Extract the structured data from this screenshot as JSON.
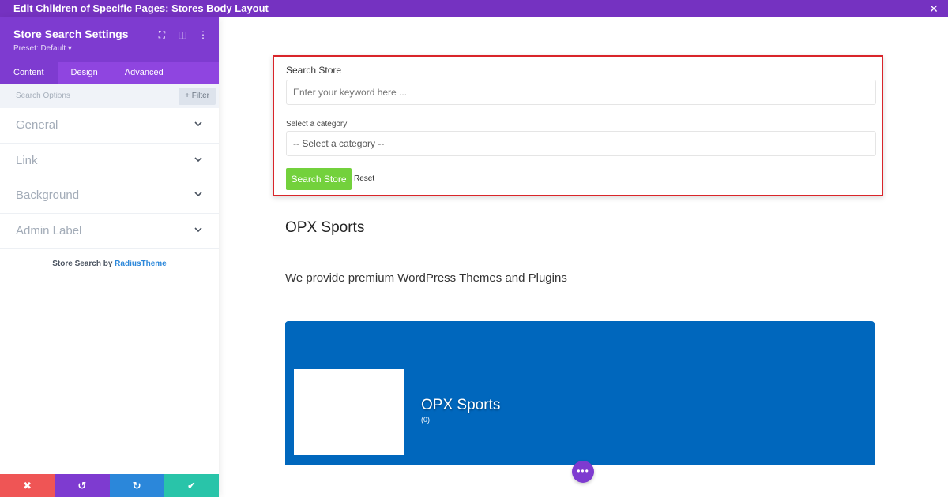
{
  "window": {
    "title": "Edit Children of Specific Pages: Stores Body Layout"
  },
  "panel": {
    "title": "Store Search Settings",
    "preset": "Preset: Default ▾",
    "tabs": [
      {
        "label": "Content",
        "active": true
      },
      {
        "label": "Design",
        "active": false
      },
      {
        "label": "Advanced",
        "active": false
      }
    ],
    "search_options": "Search Options",
    "filter_label": "Filter",
    "sections": [
      "General",
      "Link",
      "Background",
      "Admin Label"
    ],
    "credit_prefix": "Store Search by",
    "credit_link": "RadiusTheme"
  },
  "form": {
    "search_label": "Search Store",
    "keyword_placeholder": "Enter your keyword here ...",
    "category_label": "Select a category",
    "category_selected": "-- Select a category --",
    "search_button": "Search Store",
    "reset_label": "Reset"
  },
  "store": {
    "title": "OPX Sports",
    "description": "We provide premium WordPress Themes and Plugins",
    "card_name": "OPX Sports",
    "card_count": "(0)"
  },
  "colors": {
    "accent": "#7e3bd0",
    "topbar": "#7532c1",
    "highlight_border": "#d9252a",
    "search_button": "#73d13c",
    "card_bg": "#0067bd"
  }
}
